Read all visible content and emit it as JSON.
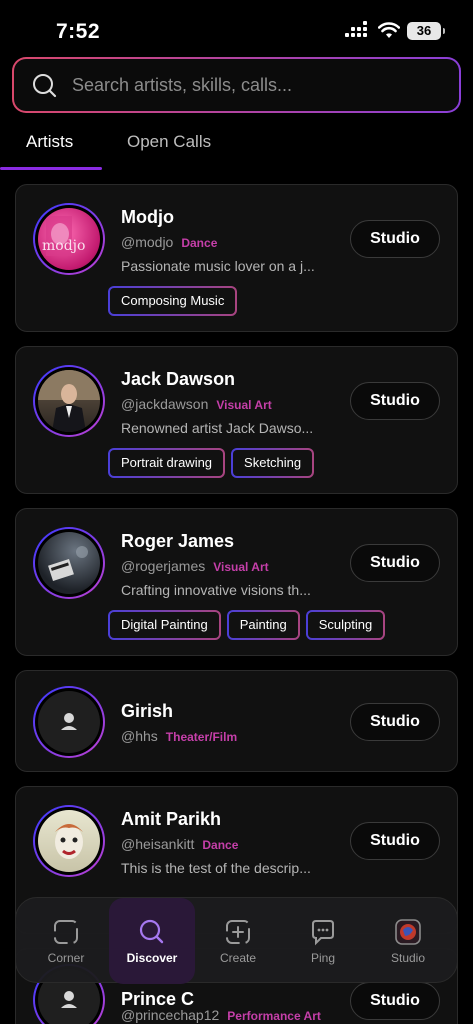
{
  "status": {
    "time": "7:52",
    "battery": "36"
  },
  "search": {
    "placeholder": "Search artists, skills, calls..."
  },
  "tabs": [
    {
      "label": "Artists"
    },
    {
      "label": "Open Calls"
    }
  ],
  "artists": [
    {
      "name": "Modjo",
      "handle": "@modjo",
      "category": "Dance",
      "description": "Passionate music lover on a j...",
      "tags": [
        "Composing Music"
      ]
    },
    {
      "name": "Jack Dawson",
      "handle": "@jackdawson",
      "category": "Visual Art",
      "description": "Renowned artist Jack Dawso...",
      "tags": [
        "Portrait drawing",
        "Sketching"
      ]
    },
    {
      "name": "Roger James",
      "handle": "@rogerjames",
      "category": "Visual Art",
      "description": "Crafting innovative visions th...",
      "tags": [
        "Digital Painting",
        "Painting",
        "Sculpting"
      ]
    },
    {
      "name": "Girish",
      "handle": "@hhs",
      "category": "Theater/Film",
      "description": "",
      "tags": []
    },
    {
      "name": "Amit Parikh",
      "handle": "@heisankitt",
      "category": "Dance",
      "description": "This is the test of the descrip...",
      "tags": []
    },
    {
      "name": "Prince C",
      "handle": "@princechap12",
      "category": "Performance Art",
      "description": "",
      "tags": []
    }
  ],
  "studio_label": "Studio",
  "nav": [
    {
      "label": "Corner",
      "icon": "corner-icon"
    },
    {
      "label": "Discover",
      "icon": "discover-icon"
    },
    {
      "label": "Create",
      "icon": "create-icon"
    },
    {
      "label": "Ping",
      "icon": "ping-icon"
    },
    {
      "label": "Studio",
      "icon": "studio-avatar-icon"
    }
  ],
  "colors": {
    "accent": "#8a2be2",
    "category": "#c53fa9",
    "background": "#000000",
    "card": "#111111"
  }
}
